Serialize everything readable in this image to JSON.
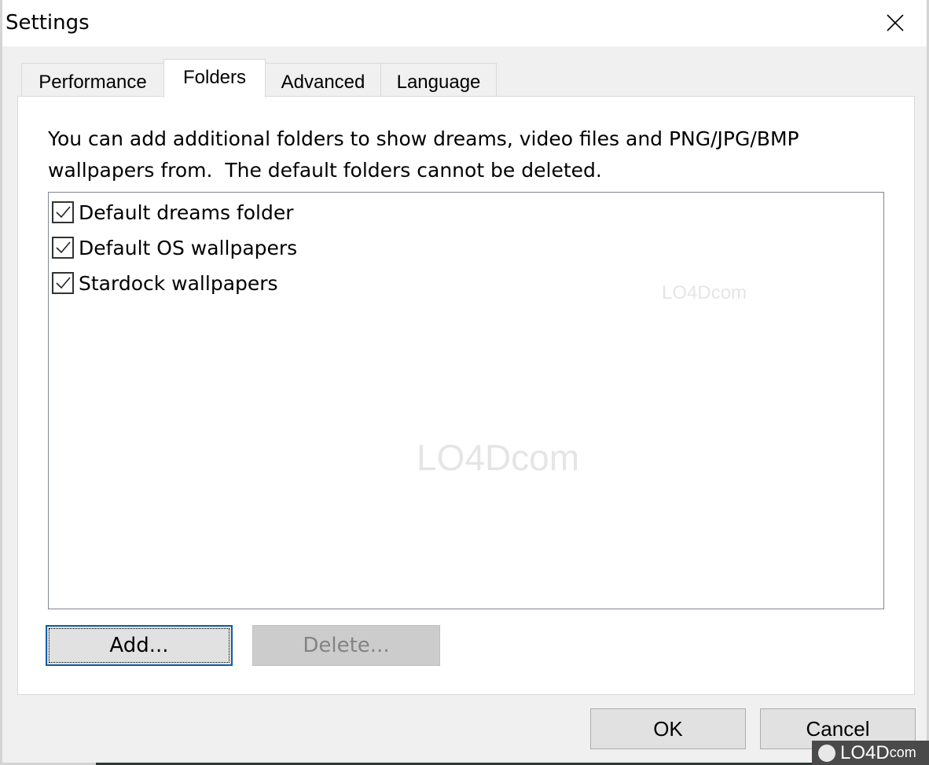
{
  "window": {
    "title": "Settings",
    "close_icon": "close-icon"
  },
  "tabs": [
    {
      "label": "Performance",
      "active": false
    },
    {
      "label": "Folders",
      "active": true
    },
    {
      "label": "Advanced",
      "active": false
    },
    {
      "label": "Language",
      "active": false
    }
  ],
  "folders_tab": {
    "description": "You can add additional folders to show dreams, video files and PNG/JPG/BMP\nwallpapers from.  The default folders cannot be deleted.",
    "folders": [
      {
        "label": "Default dreams folder",
        "checked": true
      },
      {
        "label": "Default OS wallpapers",
        "checked": true
      },
      {
        "label": "Stardock wallpapers",
        "checked": true
      }
    ],
    "add_label": "Add...",
    "delete_label": "Delete...",
    "delete_enabled": false
  },
  "footer": {
    "ok_label": "OK",
    "cancel_label": "Cancel"
  },
  "watermark": {
    "text": "LO4D",
    "suffix": "com"
  },
  "colors": {
    "focus_border": "#0f5ea8",
    "dialog_bg": "#f0f0f0",
    "panel_bg": "#ffffff"
  }
}
